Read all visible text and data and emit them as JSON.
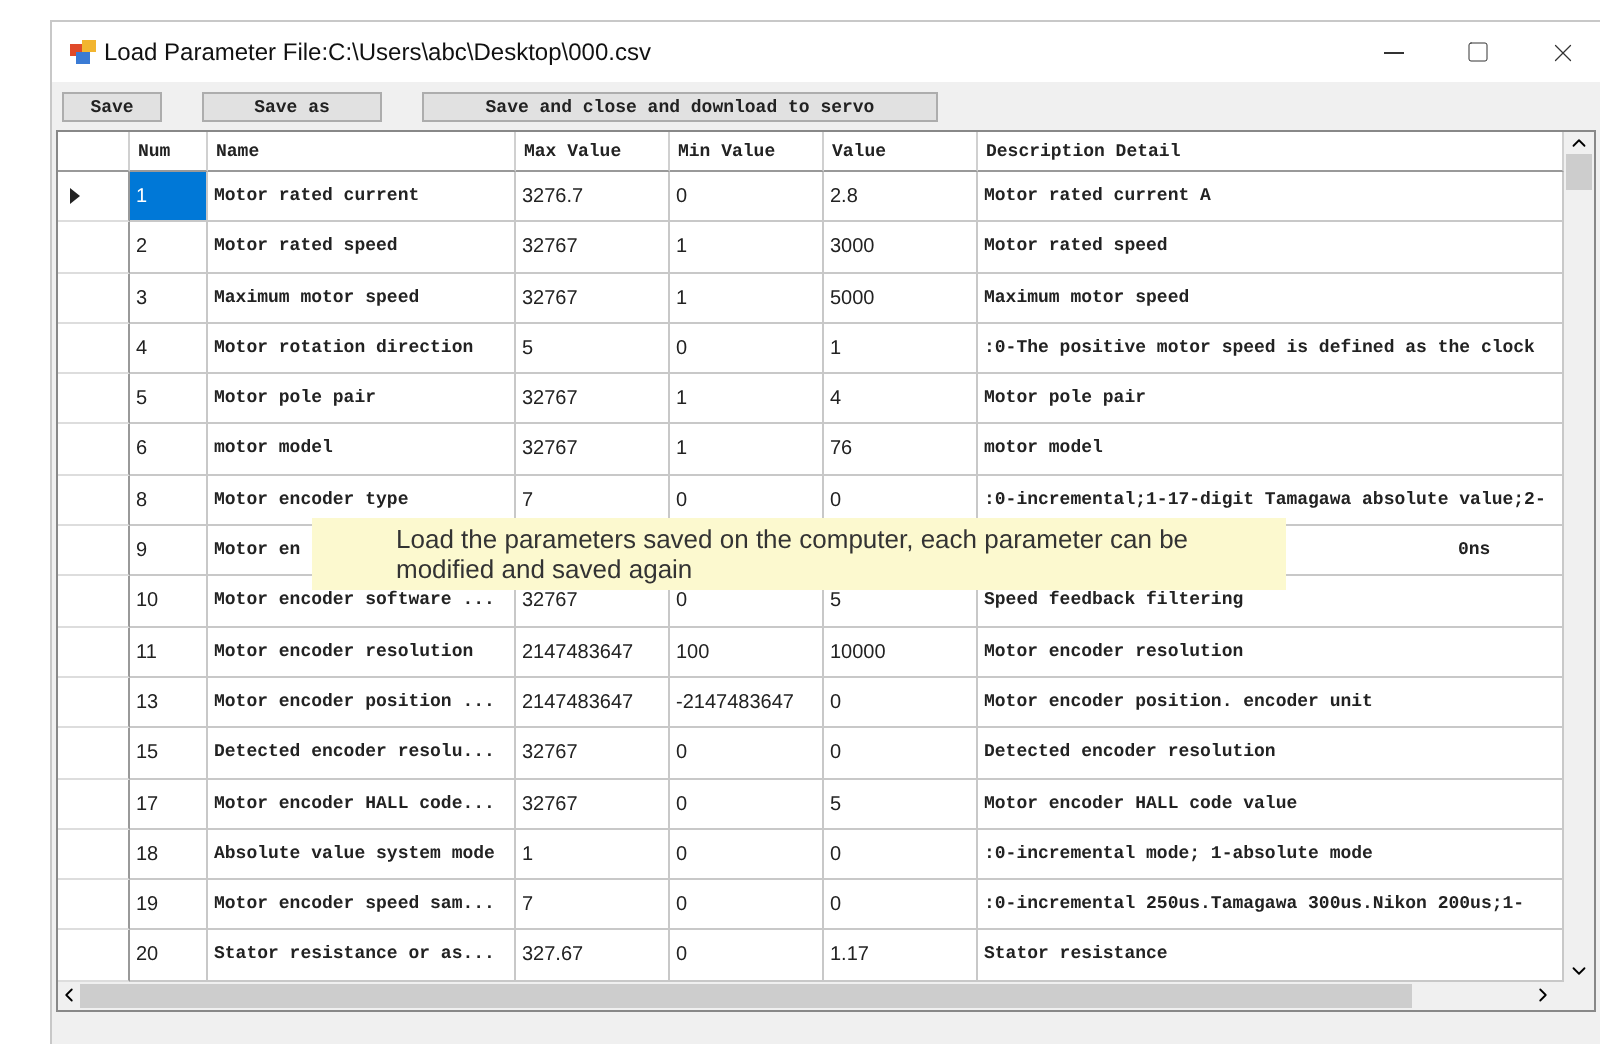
{
  "window": {
    "title": "Load Parameter File:C:\\Users\\abc\\Desktop\\000.csv"
  },
  "toolbar": [
    "Save",
    "Save as",
    "Save and close and download to servo"
  ],
  "table": {
    "columns": [
      "Num",
      "Name",
      "Max Value",
      "Min Value",
      "Value",
      "Description Detail"
    ],
    "rows": [
      {
        "current": true,
        "selected": true,
        "cells": [
          "1",
          "Motor rated current",
          "3276.7",
          "0",
          "2.8",
          "Motor rated current A"
        ]
      },
      {
        "current": false,
        "selected": false,
        "cells": [
          "2",
          "Motor rated speed",
          "32767",
          "1",
          "3000",
          "Motor rated speed"
        ]
      },
      {
        "current": false,
        "selected": false,
        "cells": [
          "3",
          "Maximum motor speed",
          "32767",
          "1",
          "5000",
          "Maximum motor speed"
        ]
      },
      {
        "current": false,
        "selected": false,
        "cells": [
          "4",
          "Motor rotation direction",
          "5",
          "0",
          "1",
          ":0-The positive motor speed is defined as the clock"
        ]
      },
      {
        "current": false,
        "selected": false,
        "cells": [
          "5",
          "Motor pole pair",
          "32767",
          "1",
          "4",
          "Motor pole pair"
        ]
      },
      {
        "current": false,
        "selected": false,
        "cells": [
          "6",
          "motor model",
          "32767",
          "1",
          "76",
          "motor model"
        ]
      },
      {
        "current": false,
        "selected": false,
        "cells": [
          "8",
          "Motor encoder type",
          "7",
          "0",
          "0",
          ":0-incremental;1-17-digit Tamagawa absolute value;2-"
        ]
      },
      {
        "current": false,
        "selected": false,
        "covered": true,
        "cells": [
          "9",
          "Motor en",
          null,
          null,
          null,
          "0ns"
        ]
      },
      {
        "current": false,
        "selected": false,
        "cells": [
          "10",
          "Motor encoder software ...",
          "32767",
          "0",
          "5",
          "Speed feedback filtering"
        ]
      },
      {
        "current": false,
        "selected": false,
        "cells": [
          "11",
          "Motor encoder resolution",
          "2147483647",
          "100",
          "10000",
          "Motor encoder resolution"
        ]
      },
      {
        "current": false,
        "selected": false,
        "cells": [
          "13",
          "Motor encoder position ...",
          "2147483647",
          "-2147483647",
          "0",
          "Motor encoder position. encoder unit"
        ]
      },
      {
        "current": false,
        "selected": false,
        "cells": [
          "15",
          "Detected encoder resolu...",
          "32767",
          "0",
          "0",
          "Detected encoder resolution"
        ]
      },
      {
        "current": false,
        "selected": false,
        "cells": [
          "17",
          "Motor encoder HALL code...",
          "32767",
          "0",
          "5",
          "Motor encoder HALL code value"
        ]
      },
      {
        "current": false,
        "selected": false,
        "cells": [
          "18",
          "Absolute value system mode",
          "1",
          "0",
          "0",
          ":0-incremental mode; 1-absolute mode"
        ]
      },
      {
        "current": false,
        "selected": false,
        "cells": [
          "19",
          "Motor encoder speed sam...",
          "7",
          "0",
          "0",
          ":0-incremental 250us.Tamagawa 300us.Nikon 200us;1-"
        ]
      },
      {
        "current": false,
        "selected": false,
        "cells": [
          "20",
          "Stator resistance or as...",
          "327.67",
          "0",
          "1.17",
          "Stator resistance"
        ]
      }
    ]
  },
  "tooltip": "Load the parameters saved on the computer, each parameter can be modified and saved again"
}
